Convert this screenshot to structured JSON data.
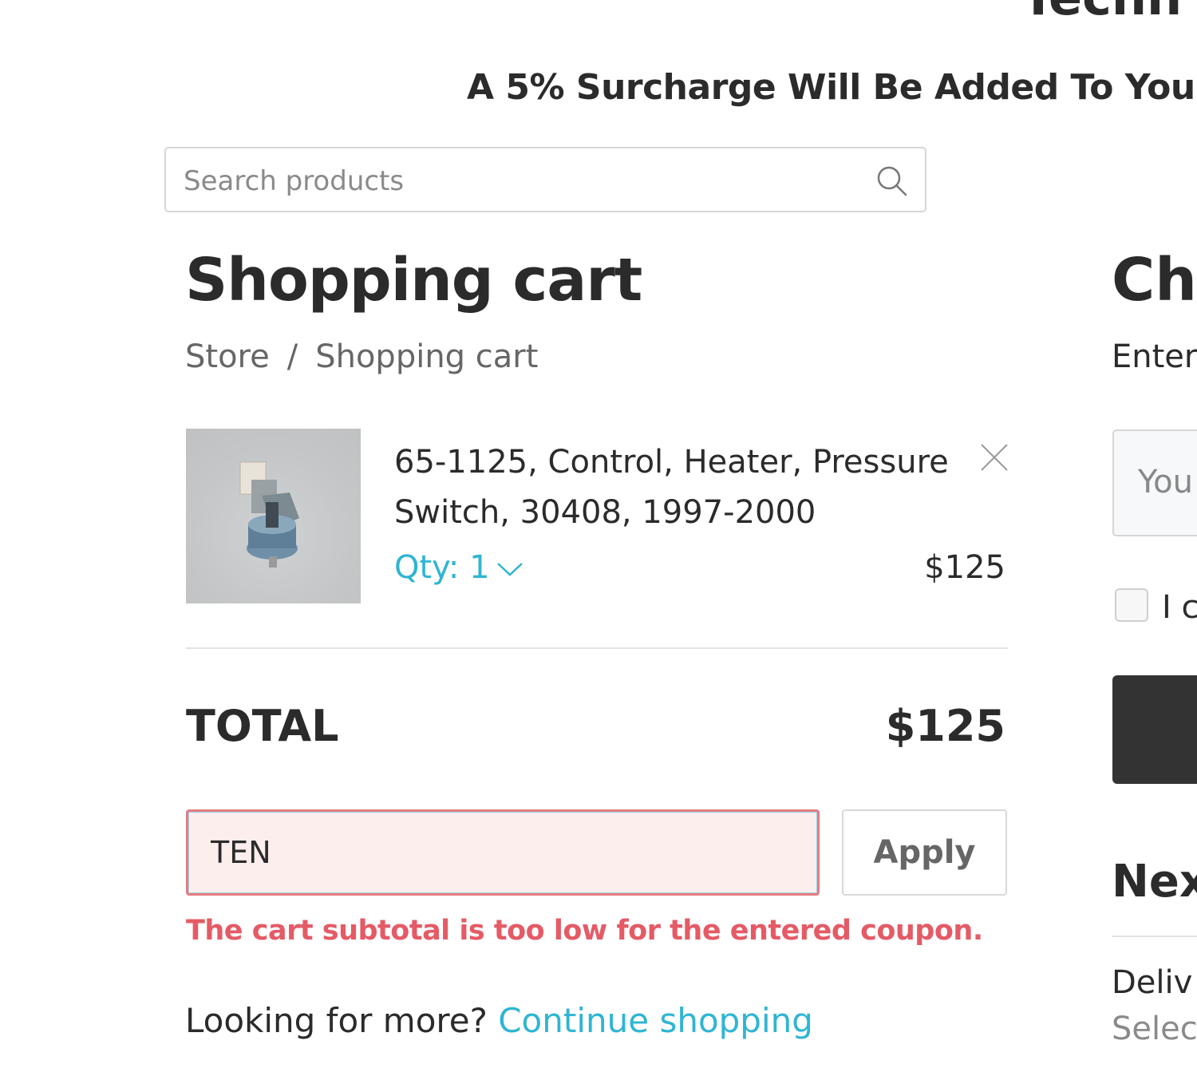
{
  "header": {
    "site_title": "Techn",
    "banner": "A 5% Surcharge Will Be Added To You"
  },
  "search": {
    "placeholder": "Search products",
    "icon": "search-icon"
  },
  "cart": {
    "title": "Shopping cart",
    "breadcrumb": {
      "store": "Store",
      "separator": "/",
      "current": "Shopping cart"
    },
    "items": [
      {
        "name": "65-1125, Control, Heater, Pressure Switch, 30408, 1997-2000",
        "qty_label": "Qty: 1",
        "price": "$125",
        "remove_icon": "close-icon"
      }
    ],
    "total_label": "TOTAL",
    "total_value": "$125",
    "coupon": {
      "value": "TEN",
      "apply_label": "Apply",
      "error": "The cart subtotal is too low for the entered coupon."
    },
    "more_prompt": "Looking for more?",
    "continue_link": "Continue shopping"
  },
  "checkout": {
    "title": "Ch",
    "enter_text": "Enter",
    "email_placeholder": "You",
    "agree_label": "I c",
    "next_title": "Nex",
    "delivery_label": "Deliv",
    "delivery_sub": "Selec"
  },
  "colors": {
    "accent": "#2fb5d3",
    "error": "#e45b66",
    "text": "#2b2b2b",
    "dark_button": "#333333"
  }
}
